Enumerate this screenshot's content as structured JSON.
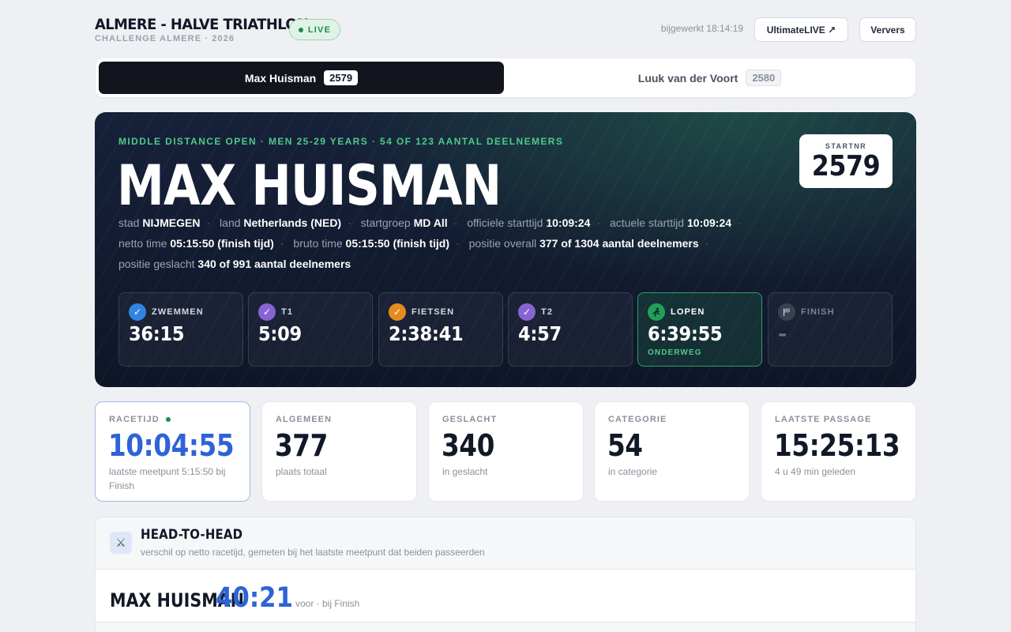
{
  "header": {
    "title": "ALMERE - HALVE TRIATHLON",
    "subtitle": "CHALLENGE ALMERE · 2026",
    "live_label": "LIVE",
    "updated": "bijgewerkt 18:14:19",
    "ultimatelive_label": "UltimateLIVE ↗",
    "refresh_label": "Ververs"
  },
  "tabs": [
    {
      "name": "Max Huisman",
      "bib": "2579",
      "active": true
    },
    {
      "name": "Luuk van der Voort",
      "bib": "2580",
      "active": false
    }
  ],
  "athlete": {
    "tagline": "MIDDLE DISTANCE OPEN · MEN 25-29 YEARS · 54 OF 123 AANTAL DEELNEMERS",
    "name": "MAX HUISMAN",
    "startnr_label": "STARTNR",
    "startnr": "2579",
    "meta": [
      {
        "label": "stad",
        "value": "NIJMEGEN"
      },
      {
        "label": "land",
        "value": "Netherlands (NED)"
      },
      {
        "label": "startgroep",
        "value": "MD All"
      },
      {
        "label": "officiele starttijd",
        "value": "10:09:24"
      },
      {
        "label": "actuele starttijd",
        "value": "10:09:24"
      },
      {
        "label": "netto time",
        "value": "05:15:50 (finish tijd)"
      },
      {
        "label": "bruto time",
        "value": "05:15:50 (finish tijd)"
      },
      {
        "label": "positie overall",
        "value": "377 of 1304 aantal deelnemers"
      },
      {
        "label": "positie geslacht",
        "value": "340 of 991 aantal deelnemers"
      }
    ],
    "splits": [
      {
        "name": "ZWEMMEN",
        "time": "36:15",
        "icon": "check-icon",
        "color": "#2f86e0",
        "status": "done",
        "sub": ""
      },
      {
        "name": "T1",
        "time": "5:09",
        "icon": "check-icon",
        "color": "#8a63d2",
        "status": "done",
        "sub": ""
      },
      {
        "name": "FIETSEN",
        "time": "2:38:41",
        "icon": "check-icon",
        "color": "#e58a1f",
        "status": "done",
        "sub": ""
      },
      {
        "name": "T2",
        "time": "4:57",
        "icon": "check-icon",
        "color": "#8a63d2",
        "status": "done",
        "sub": ""
      },
      {
        "name": "LOPEN",
        "time": "6:39:55",
        "icon": "runner-icon",
        "color": "#22a05a",
        "status": "active",
        "sub": "ONDERWEG"
      },
      {
        "name": "FINISH",
        "time": "–",
        "icon": "flag-icon",
        "color": "#3a4152",
        "status": "pending",
        "sub": ""
      }
    ]
  },
  "stats": [
    {
      "label": "RACETIJD",
      "value": "10:04:55",
      "sub": "laatste meetpunt 5:15:50 bij Finish",
      "highlight": true
    },
    {
      "label": "ALGEMEEN",
      "value": "377",
      "sub": "plaats totaal",
      "highlight": false
    },
    {
      "label": "GESLACHT",
      "value": "340",
      "sub": "in geslacht",
      "highlight": false
    },
    {
      "label": "CATEGORIE",
      "value": "54",
      "sub": "in categorie",
      "highlight": false
    },
    {
      "label": "LAATSTE PASSAGE",
      "value": "15:25:13",
      "sub": "4 u 49 min geleden",
      "highlight": false
    }
  ],
  "h2h": {
    "title": "HEAD-TO-HEAD",
    "subtitle": "verschil op netto racetijd, gemeten bij het laatste meetpunt dat beiden passeerden",
    "leader": "MAX HUISMAN",
    "gap": "40:21",
    "note": "voor · bij Finish"
  },
  "colors": {
    "accent": "#2e63d8",
    "live": "#1f8a4c",
    "hero_bg": "#121b30",
    "active_split": "#2f9e66"
  }
}
